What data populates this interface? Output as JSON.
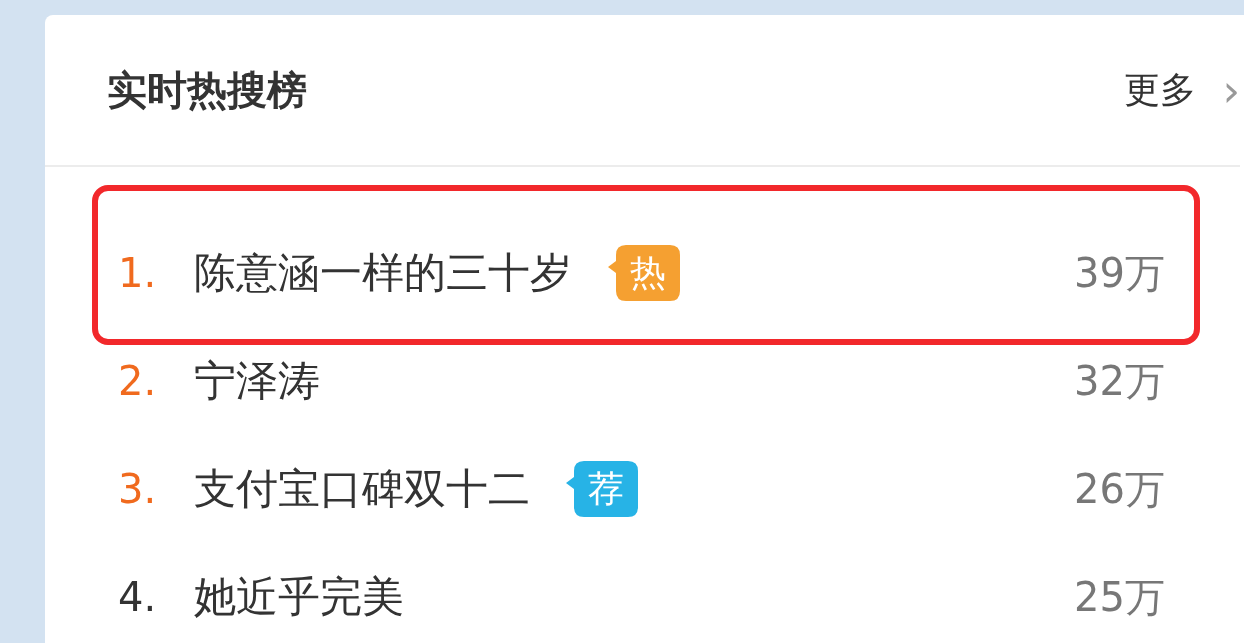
{
  "panel": {
    "title": "实时热搜榜",
    "more_link": "更多",
    "more_arrow": "›"
  },
  "rows": [
    {
      "rank": "1.",
      "topic": "陈意涵一样的三十岁",
      "badge": {
        "kind": "hot",
        "label": "热"
      },
      "count": "39万",
      "highlighted": true
    },
    {
      "rank": "2.",
      "topic": "宁泽涛",
      "count": "32万",
      "highlighted": false
    },
    {
      "rank": "3.",
      "topic": "支付宝口碑双十二",
      "badge": {
        "kind": "recommend",
        "label": "荐"
      },
      "count": "26万",
      "highlighted": false
    },
    {
      "rank": "4.",
      "topic": "她近乎完美",
      "count": "25万",
      "highlighted": false
    }
  ]
}
